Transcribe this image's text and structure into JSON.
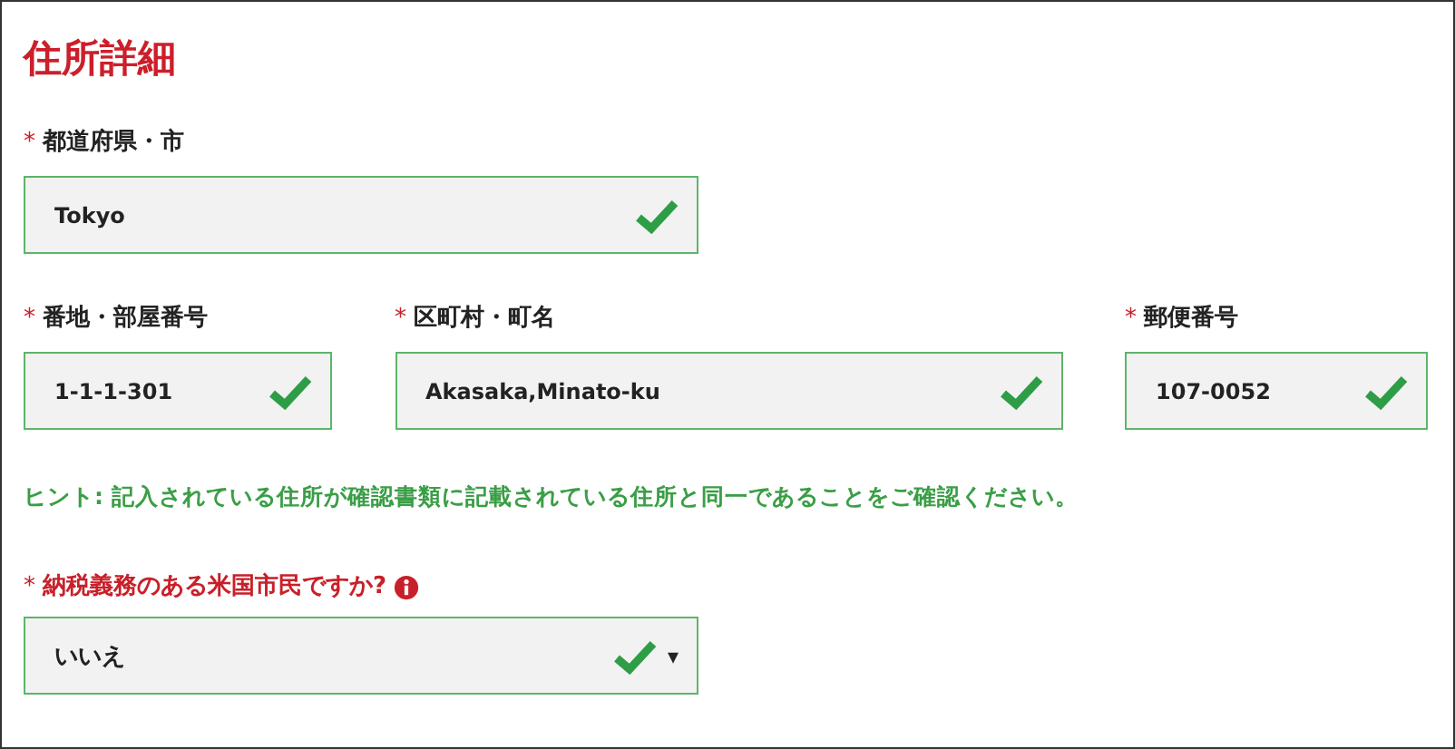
{
  "title": "住所詳細",
  "row_1": [
    {
      "mark": "*",
      "label": "都道府県・市",
      "value": "Tokyo",
      "valid": true
    }
  ],
  "row_2": [
    {
      "mark": "*",
      "label": "番地・部屋番号",
      "value": "1-1-1-301",
      "valid": true
    },
    {
      "mark": "*",
      "label": "区町村・町名",
      "value": "Akasaka,Minato-ku",
      "valid": true
    },
    {
      "mark": "*",
      "label": "郵便番号",
      "value": "107-0052",
      "valid": true
    }
  ],
  "hint": "ヒント: 記入されている住所が確認書類に記載されている住所と同一であることをご確認ください。",
  "question": {
    "mark": "*",
    "label": "納税義務のある米国市民ですか?",
    "info": true,
    "value": "いいえ",
    "valid": true,
    "caret": "▾"
  }
}
